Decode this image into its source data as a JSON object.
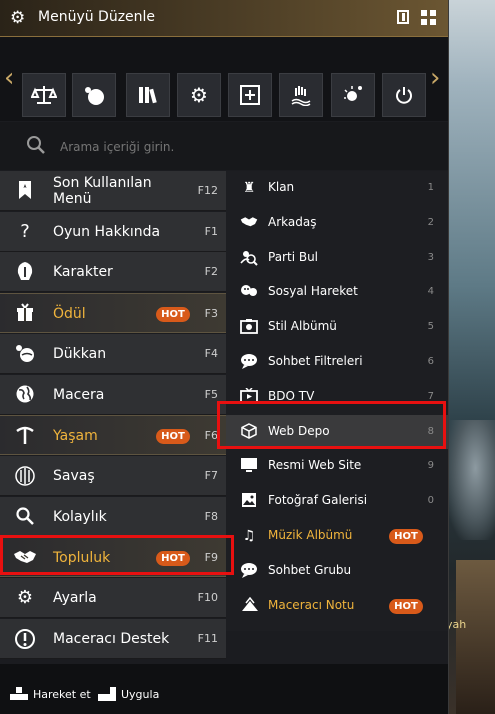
{
  "window": {
    "title": "Menüyü Düzenle"
  },
  "toolbar": {
    "icons": [
      "scales-book-icon",
      "globe-fire-icon",
      "books-icon",
      "gear-icon",
      "expand-square-icon",
      "hand-water-icon",
      "spark-icon",
      "power-icon"
    ]
  },
  "search": {
    "placeholder": "Arama içeriği girin."
  },
  "left_menu": [
    {
      "label": "Son Kullanılan Menü",
      "key": "F12",
      "hot": false,
      "icon": "bookmark-icon"
    },
    {
      "label": "Oyun Hakkında",
      "key": "F1",
      "hot": false,
      "icon": "question-icon"
    },
    {
      "label": "Karakter",
      "key": "F2",
      "hot": false,
      "icon": "helmet-icon"
    },
    {
      "label": "Ödül",
      "key": "F3",
      "hot": true,
      "hot_label": "HOT",
      "icon": "gift-icon"
    },
    {
      "label": "Dükkan",
      "key": "F4",
      "hot": false,
      "icon": "shop-icon"
    },
    {
      "label": "Macera",
      "key": "F5",
      "hot": false,
      "icon": "globe-icon"
    },
    {
      "label": "Yaşam",
      "key": "F6",
      "hot": true,
      "hot_label": "HOT",
      "icon": "pickaxe-icon"
    },
    {
      "label": "Savaş",
      "key": "F7",
      "hot": false,
      "icon": "swords-icon"
    },
    {
      "label": "Kolaylık",
      "key": "F8",
      "hot": false,
      "icon": "search-icon"
    },
    {
      "label": "Topluluk",
      "key": "F9",
      "hot": true,
      "hot_label": "HOT",
      "icon": "handshake-icon"
    },
    {
      "label": "Ayarla",
      "key": "F10",
      "hot": false,
      "icon": "gear-icon"
    },
    {
      "label": "Maceracı Destek",
      "key": "F11",
      "hot": false,
      "icon": "help-icon"
    }
  ],
  "right_menu": [
    {
      "label": "Klan",
      "key": "1",
      "icon": "clan-icon"
    },
    {
      "label": "Arkadaş",
      "key": "2",
      "icon": "handshake-icon"
    },
    {
      "label": "Parti Bul",
      "key": "3",
      "icon": "party-search-icon"
    },
    {
      "label": "Sosyal Hareket",
      "key": "4",
      "icon": "emote-icon"
    },
    {
      "label": "Stil Albümü",
      "key": "5",
      "icon": "camera-icon"
    },
    {
      "label": "Sohbet Filtreleri",
      "key": "6",
      "icon": "chat-filter-icon"
    },
    {
      "label": "BDO TV",
      "key": "7",
      "icon": "tv-icon"
    },
    {
      "label": "Web Depo",
      "key": "8",
      "icon": "box-icon"
    },
    {
      "label": "Resmi Web Site",
      "key": "9",
      "icon": "monitor-icon"
    },
    {
      "label": "Fotoğraf Galerisi",
      "key": "0",
      "icon": "gallery-icon"
    },
    {
      "label": "Müzik Albümü",
      "key": "",
      "hot_label": "HOT",
      "icon": "music-icon"
    },
    {
      "label": "Sohbet Grubu",
      "key": "",
      "icon": "chat-group-icon"
    },
    {
      "label": "Maceracı Notu",
      "key": "",
      "hot_label": "HOT",
      "icon": "scroll-icon"
    }
  ],
  "footer": {
    "move_label": "Hareket et",
    "apply_label": "Uygula"
  },
  "background_text": [
    "yah"
  ],
  "colors": {
    "gold": "#f0b43c",
    "hot_badge": "#d85a1a",
    "highlight_red": "#e81010"
  }
}
